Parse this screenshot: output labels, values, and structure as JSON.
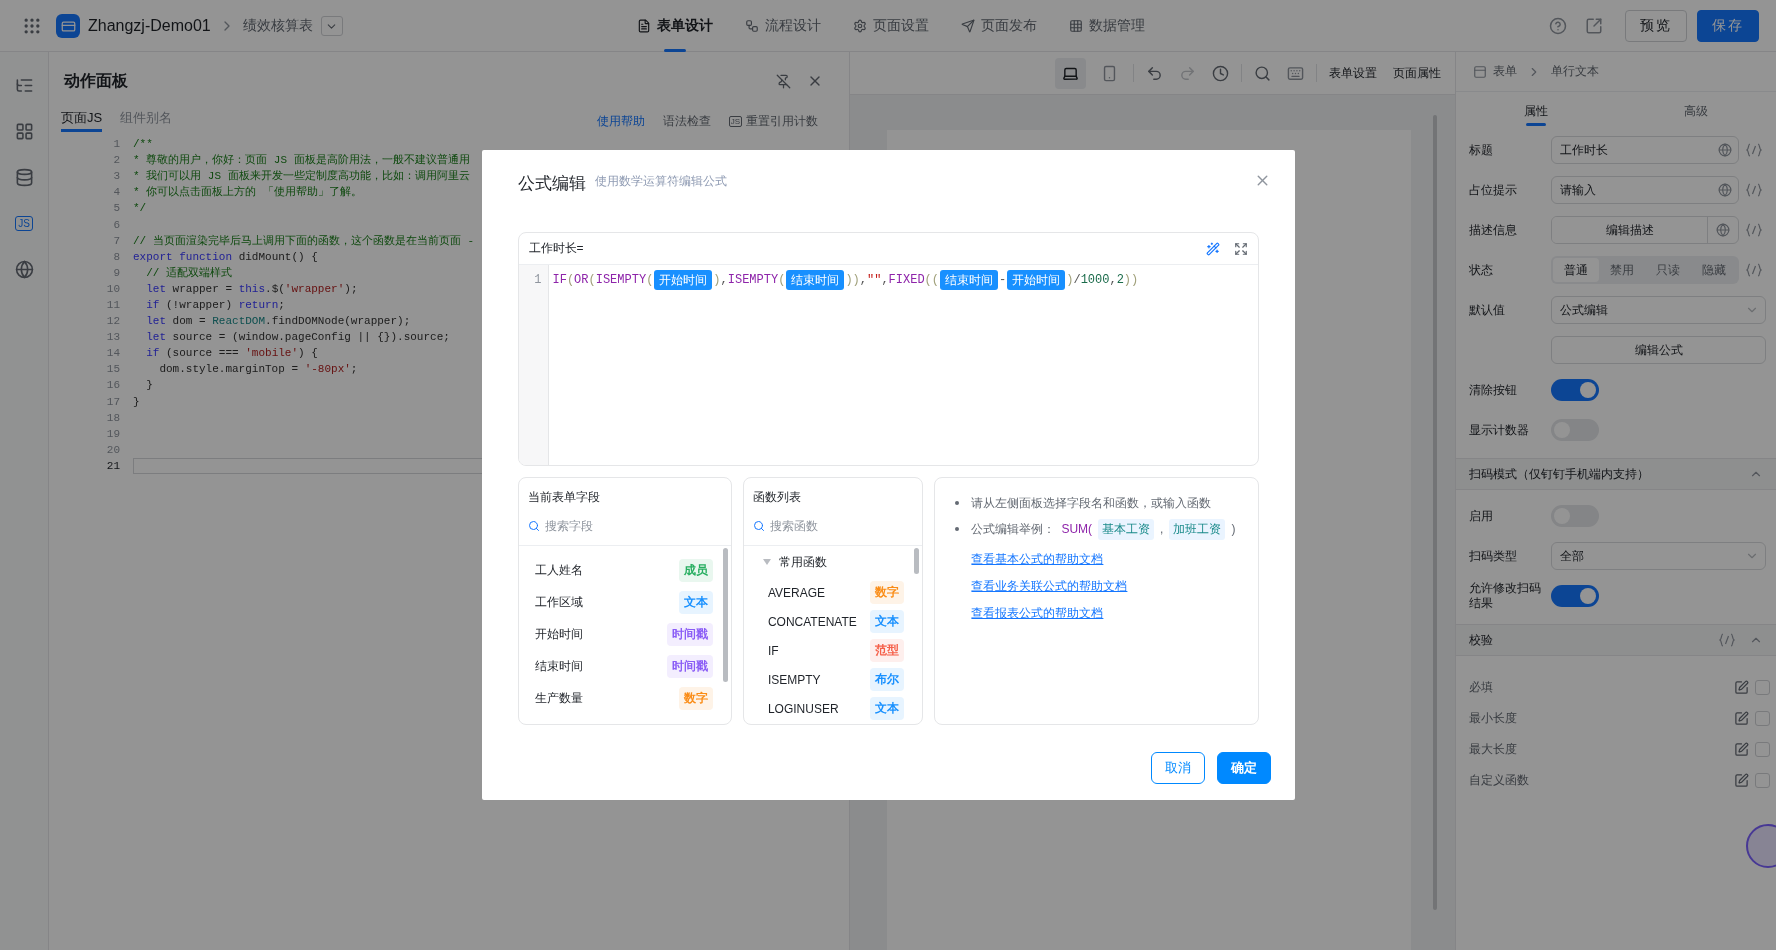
{
  "top_bar": {
    "app_name": "Zhangzj-Demo01",
    "page_name": "绩效核算表",
    "nav_tabs": [
      {
        "label": "表单设计",
        "kind": "form",
        "selected": true
      },
      {
        "label": "流程设计",
        "kind": "flow",
        "selected": false
      },
      {
        "label": "页面设置",
        "kind": "settings",
        "selected": false
      },
      {
        "label": "页面发布",
        "kind": "publish",
        "selected": false
      },
      {
        "label": "数据管理",
        "kind": "data",
        "selected": false
      }
    ],
    "buttons": [
      {
        "label": "预览",
        "kind": "default"
      },
      {
        "label": "保存",
        "kind": "primary"
      }
    ]
  },
  "left_rail": [
    {
      "kind": "outline",
      "selected": false
    },
    {
      "kind": "components",
      "selected": false
    },
    {
      "kind": "datasource",
      "selected": false
    },
    {
      "kind": "js",
      "label": "JS",
      "selected": true
    },
    {
      "kind": "globe",
      "selected": false
    }
  ],
  "action_panel": {
    "title": "动作面板",
    "tabs": [
      {
        "label": "页面JS",
        "selected": true
      },
      {
        "label": "组件别名",
        "selected": false
      }
    ],
    "links": [
      {
        "label": "使用帮助",
        "kind": "primary"
      },
      {
        "label": "语法检查",
        "kind": "plain"
      },
      {
        "label": "重置引用计数",
        "kind": "badge",
        "badge": "JS"
      }
    ],
    "code_lines": [
      {
        "number": "1",
        "active": false,
        "tokens": [
          {
            "kind": "comment",
            "text": "/**"
          }
        ]
      },
      {
        "number": "2",
        "active": false,
        "tokens": [
          {
            "kind": "comment",
            "text": "* 尊敬的用户，你好：页面 JS 面板是高阶用法，一般不建议普通用"
          }
        ]
      },
      {
        "number": "3",
        "active": false,
        "tokens": [
          {
            "kind": "comment",
            "text": "* 我们可以用 JS 面板来开发一些定制度高功能，比如：调用阿里云"
          }
        ]
      },
      {
        "number": "4",
        "active": false,
        "tokens": [
          {
            "kind": "comment",
            "text": "* 你可以点击面板上方的 「使用帮助」了解。"
          }
        ]
      },
      {
        "number": "5",
        "active": false,
        "tokens": [
          {
            "kind": "comment",
            "text": "*/"
          }
        ]
      },
      {
        "number": "6",
        "active": false
      },
      {
        "number": "7",
        "active": false,
        "tokens": [
          {
            "kind": "comment",
            "text": "// 当页面渲染完毕后马上调用下面的函数，这个函数是在当前页面 -"
          }
        ]
      },
      {
        "number": "8",
        "active": false,
        "tokens": [
          {
            "kind": "keyword",
            "text": "export function"
          },
          {
            "kind": "plain",
            "text": " didMount() {"
          }
        ]
      },
      {
        "number": "9",
        "active": false,
        "tokens": [
          {
            "kind": "comment",
            "text": "  // 适配双端样式"
          }
        ]
      },
      {
        "number": "10",
        "active": false,
        "tokens": [
          {
            "kind": "keyword",
            "text": "  let"
          },
          {
            "kind": "plain",
            "text": " wrapper = "
          },
          {
            "kind": "keyword",
            "text": "this"
          },
          {
            "kind": "plain",
            "text": ".$("
          },
          {
            "kind": "string",
            "text": "'wrapper'"
          },
          {
            "kind": "plain",
            "text": ");"
          }
        ]
      },
      {
        "number": "11",
        "active": false,
        "tokens": [
          {
            "kind": "keyword",
            "text": "  if"
          },
          {
            "kind": "plain",
            "text": " (!wrapper) "
          },
          {
            "kind": "keyword",
            "text": "return"
          },
          {
            "kind": "plain",
            "text": ";"
          }
        ]
      },
      {
        "number": "12",
        "active": false,
        "tokens": [
          {
            "kind": "keyword",
            "text": "  let"
          },
          {
            "kind": "plain",
            "text": " dom = "
          },
          {
            "kind": "class",
            "text": "ReactDOM"
          },
          {
            "kind": "plain",
            "text": ".findDOMNode(wrapper);"
          }
        ]
      },
      {
        "number": "13",
        "active": false,
        "tokens": [
          {
            "kind": "keyword",
            "text": "  let"
          },
          {
            "kind": "plain",
            "text": " source = (window.pageConfig || {}).source;"
          }
        ]
      },
      {
        "number": "14",
        "active": false,
        "tokens": [
          {
            "kind": "keyword",
            "text": "  if"
          },
          {
            "kind": "plain",
            "text": " (source === "
          },
          {
            "kind": "string",
            "text": "'mobile'"
          },
          {
            "kind": "plain",
            "text": ") {"
          }
        ]
      },
      {
        "number": "15",
        "active": false,
        "tokens": [
          {
            "kind": "plain",
            "text": "    dom.style.marginTop = "
          },
          {
            "kind": "string",
            "text": "'-80px'"
          },
          {
            "kind": "plain",
            "text": ";"
          }
        ]
      },
      {
        "number": "16",
        "active": false,
        "tokens": [
          {
            "kind": "plain",
            "text": "  }"
          }
        ]
      },
      {
        "number": "17",
        "active": false,
        "tokens": [
          {
            "kind": "plain",
            "text": "}"
          }
        ]
      },
      {
        "number": "18",
        "active": false
      },
      {
        "number": "19",
        "active": false
      },
      {
        "number": "20",
        "active": false
      },
      {
        "number": "21",
        "active": true
      }
    ]
  },
  "canvas_toolbar": {
    "devices": [
      {
        "kind": "desktop",
        "selected": true
      },
      {
        "kind": "mobile",
        "selected": false
      }
    ],
    "links": [
      "表单设置",
      "页面属性"
    ]
  },
  "properties": {
    "breadcrumb": [
      "表单",
      "单行文本"
    ],
    "tabs": [
      {
        "label": "属性",
        "selected": true
      },
      {
        "label": "高级",
        "selected": false
      }
    ],
    "fields": [
      {
        "kind": "input",
        "label": "标题",
        "value": "工作时长"
      },
      {
        "kind": "input",
        "label": "占位提示",
        "value": "请输入"
      },
      {
        "kind": "button",
        "label": "描述信息",
        "value": "编辑描述"
      },
      {
        "kind": "segmented",
        "label": "状态",
        "options": [
          {
            "label": "普通",
            "selected": true
          },
          {
            "label": "禁用",
            "selected": false
          },
          {
            "label": "只读",
            "selected": false
          },
          {
            "label": "隐藏",
            "selected": false
          }
        ]
      },
      {
        "kind": "select",
        "label": "默认值",
        "value": "公式编辑"
      },
      {
        "kind": "wide_button",
        "value": "编辑公式"
      },
      {
        "kind": "switch",
        "label": "清除按钮",
        "on": true
      },
      {
        "kind": "switch",
        "label": "显示计数器",
        "on": false
      }
    ],
    "scan_section": {
      "title": "扫码模式（仅钉钉手机端内支持）",
      "expanded": true,
      "fields": [
        {
          "kind": "switch",
          "label": "启用",
          "on": false
        },
        {
          "kind": "select",
          "label": "扫码类型",
          "value": "全部"
        },
        {
          "kind": "switch",
          "label": "允许修改扫码结果",
          "on": true
        }
      ]
    },
    "validation": {
      "title": "校验",
      "expanded": true,
      "rules": [
        {
          "label": "必填",
          "checked": false
        },
        {
          "label": "最小长度",
          "checked": false
        },
        {
          "label": "最大长度",
          "checked": false
        },
        {
          "label": "自定义函数",
          "checked": false
        }
      ]
    }
  },
  "dialog": {
    "title": "公式编辑",
    "subtitle": "使用数学运算符编辑公式",
    "formula": {
      "label": "工作时长=",
      "line_number": "1",
      "tokens": [
        {
          "kind": "fn",
          "text": "IF"
        },
        {
          "kind": "paren",
          "text": "("
        },
        {
          "kind": "fn",
          "text": "OR"
        },
        {
          "kind": "paren",
          "text": "("
        },
        {
          "kind": "fn",
          "text": "ISEMPTY"
        },
        {
          "kind": "paren",
          "text": "("
        },
        {
          "kind": "field",
          "text": "开始时间"
        },
        {
          "kind": "paren",
          "text": ")"
        },
        {
          "kind": "plain",
          "text": ","
        },
        {
          "kind": "fn",
          "text": "ISEMPTY"
        },
        {
          "kind": "paren",
          "text": "("
        },
        {
          "kind": "field",
          "text": "结束时间"
        },
        {
          "kind": "paren",
          "text": "))"
        },
        {
          "kind": "plain",
          "text": ","
        },
        {
          "kind": "string",
          "text": "\"\""
        },
        {
          "kind": "plain",
          "text": ","
        },
        {
          "kind": "fn",
          "text": "FIXED"
        },
        {
          "kind": "paren",
          "text": "(("
        },
        {
          "kind": "field",
          "text": "结束时间"
        },
        {
          "kind": "plain",
          "text": "-"
        },
        {
          "kind": "field",
          "text": "开始时间"
        },
        {
          "kind": "paren",
          "text": ")"
        },
        {
          "kind": "plain",
          "text": "/"
        },
        {
          "kind": "number",
          "text": "1000"
        },
        {
          "kind": "plain",
          "text": ","
        },
        {
          "kind": "number",
          "text": "2"
        },
        {
          "kind": "paren",
          "text": "))"
        }
      ]
    },
    "fields_panel": {
      "title": "当前表单字段",
      "search_placeholder": "搜索字段",
      "items": [
        {
          "name": "工人姓名",
          "type": "成员",
          "color": "#27ae60"
        },
        {
          "name": "工作区域",
          "type": "文本",
          "color": "#1890ff"
        },
        {
          "name": "开始时间",
          "type": "时间戳",
          "color": "#8a5cf6"
        },
        {
          "name": "结束时间",
          "type": "时间戳",
          "color": "#8a5cf6"
        },
        {
          "name": "生产数量",
          "type": "数字",
          "color": "#fa8c16"
        }
      ]
    },
    "functions_panel": {
      "title": "函数列表",
      "search_placeholder": "搜索函数",
      "group": {
        "label": "常用函数",
        "expanded": true
      },
      "items": [
        {
          "name": "AVERAGE",
          "type": "数字",
          "color": "#fa8c16"
        },
        {
          "name": "CONCATENATE",
          "type": "文本",
          "color": "#1890ff"
        },
        {
          "name": "IF",
          "type": "范型",
          "color": "#f5604a"
        },
        {
          "name": "ISEMPTY",
          "type": "布尔",
          "color": "#1890ff"
        },
        {
          "name": "LOGINUSER",
          "type": "文本",
          "color": "#1890ff"
        }
      ]
    },
    "help": {
      "hint": "请从左侧面板选择字段名和函数，或输入函数",
      "example_label": "公式编辑举例：",
      "example_tokens": [
        {
          "kind": "fn",
          "text": "SUM("
        },
        {
          "kind": "field",
          "text": "基本工资"
        },
        {
          "kind": "plain",
          "text": ","
        },
        {
          "kind": "field",
          "text": "加班工资"
        },
        {
          "kind": "plain",
          "text": ")"
        }
      ],
      "links": [
        "查看基本公式的帮助文档",
        "查看业务关联公式的帮助文档",
        "查看报表公式的帮助文档"
      ]
    },
    "buttons": [
      {
        "label": "取消",
        "kind": "default"
      },
      {
        "label": "确定",
        "kind": "primary"
      }
    ]
  }
}
